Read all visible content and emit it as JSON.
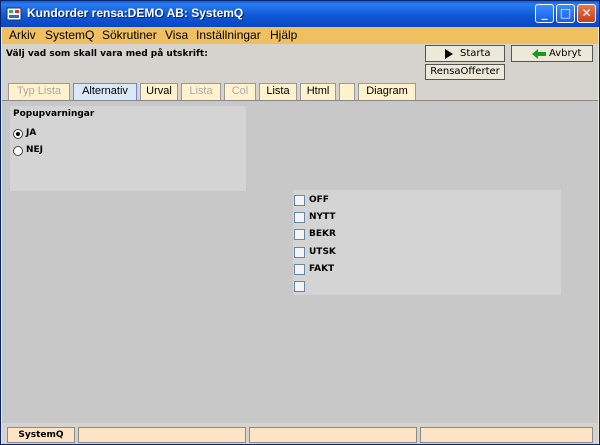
{
  "window": {
    "title": "Kundorder rensa:DEMO AB: SystemQ",
    "controls": [
      "_",
      "□",
      "✕"
    ]
  },
  "menu": {
    "items": [
      "Arkiv",
      "SystemQ",
      "Sökrutiner",
      "Visa",
      "Inställningar",
      "Hjälp"
    ]
  },
  "header": {
    "instruction": "Välj vad som skall vara med på utskrift:",
    "start_label": "Starta",
    "cancel_label": "Avbryt",
    "rensa_offerter_label": "RensaOfferter"
  },
  "tabs": [
    {
      "label": "Typ Lista",
      "disabled": true
    },
    {
      "label": "Alternativ",
      "active": true
    },
    {
      "label": "Urval"
    },
    {
      "label": "Lista",
      "disabled": true
    },
    {
      "label": "Col",
      "disabled": true
    },
    {
      "label": "Lista"
    },
    {
      "label": "Html"
    },
    {
      "label": ""
    },
    {
      "label": "Diagram"
    }
  ],
  "popup": {
    "label": "Popupvarningar",
    "options": [
      {
        "label": "JA",
        "selected": true
      },
      {
        "label": "NEJ",
        "selected": false
      }
    ]
  },
  "status_checks": [
    {
      "label": "OFF",
      "checked": false
    },
    {
      "label": "NYTT",
      "checked": false
    },
    {
      "label": "BEKR",
      "checked": false
    },
    {
      "label": "UTSK",
      "checked": false
    },
    {
      "label": "FAKT",
      "checked": false
    },
    {
      "label": "",
      "checked": false
    }
  ],
  "statusbar": {
    "cells": [
      "SystemQ",
      "",
      "",
      ""
    ]
  },
  "colors": {
    "menu_bg": "#f0c060",
    "tab_bg": "#fff2cc",
    "status_cell_bg": "#fce4c4",
    "start_arrow": "#000000",
    "cancel_arrow": "#1a9a1a"
  }
}
